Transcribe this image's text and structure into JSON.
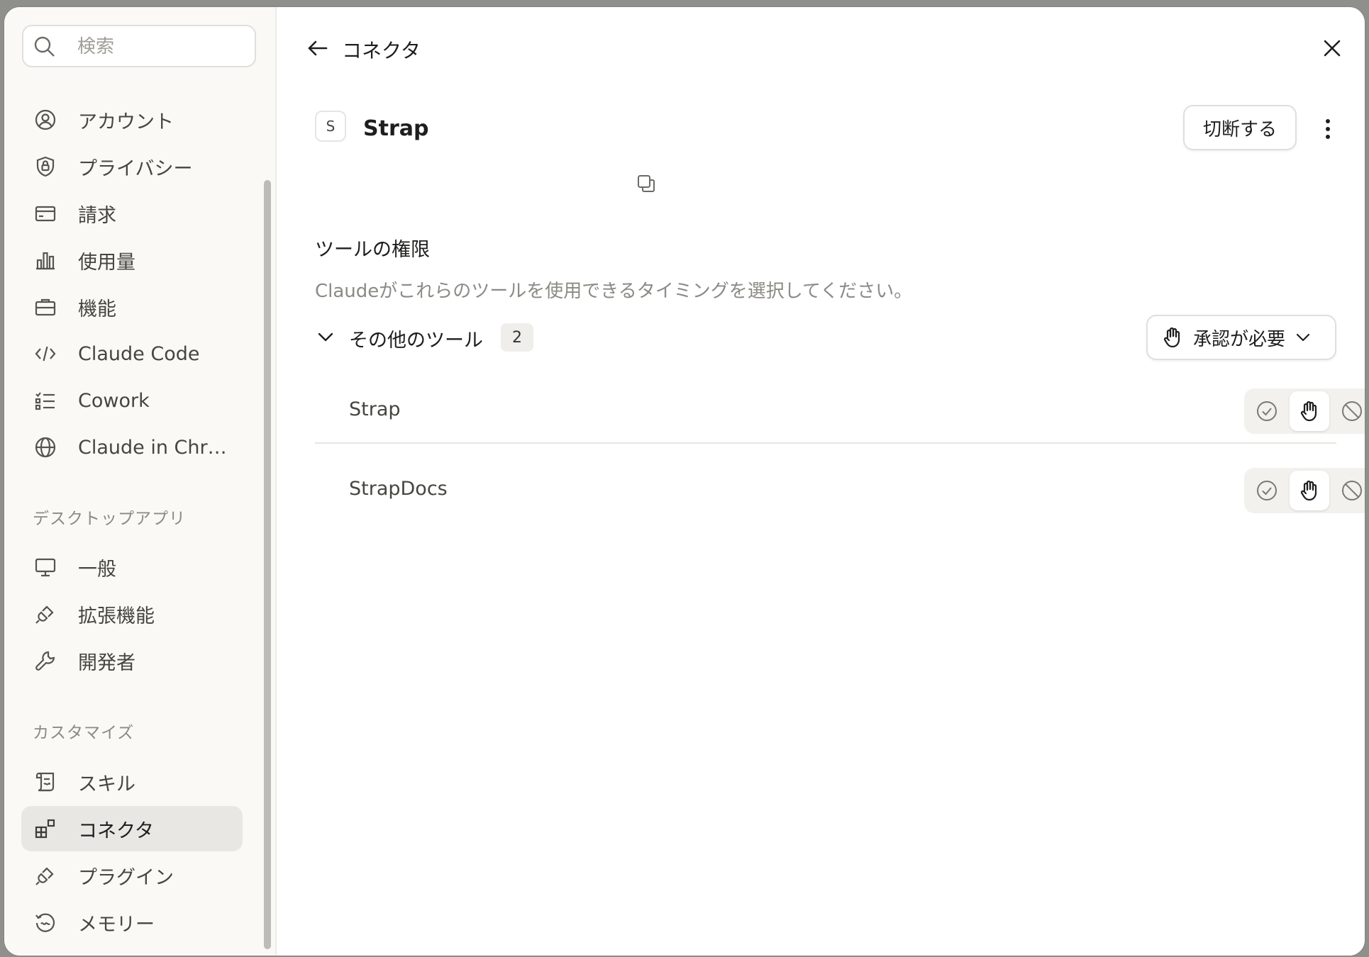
{
  "search": {
    "placeholder": "検索"
  },
  "sidebar": {
    "items": [
      {
        "label": "アカウント",
        "icon": "account-icon"
      },
      {
        "label": "プライバシー",
        "icon": "shield-lock-icon"
      },
      {
        "label": "請求",
        "icon": "credit-card-icon"
      },
      {
        "label": "使用量",
        "icon": "bar-chart-icon"
      },
      {
        "label": "機能",
        "icon": "briefcase-icon"
      },
      {
        "label": "Claude Code",
        "icon": "code-icon"
      },
      {
        "label": "Cowork",
        "icon": "checklist-icon"
      },
      {
        "label": "Claude in Chr…",
        "icon": "globe-icon"
      }
    ],
    "desktop_section_label": "デスクトップアプリ",
    "desktop_items": [
      {
        "label": "一般",
        "icon": "monitor-icon"
      },
      {
        "label": "拡張機能",
        "icon": "plug-icon"
      },
      {
        "label": "開発者",
        "icon": "wrench-icon"
      }
    ],
    "customize_section_label": "カスタマイズ",
    "customize_items": [
      {
        "label": "スキル",
        "icon": "scroll-icon"
      },
      {
        "label": "コネクタ",
        "icon": "connector-icon",
        "active": true
      },
      {
        "label": "プラグイン",
        "icon": "plug-icon"
      },
      {
        "label": "メモリー",
        "icon": "memory-icon"
      }
    ]
  },
  "header": {
    "title": "コネクタ"
  },
  "connector": {
    "badge": "S",
    "name": "Strap",
    "disconnect_label": "切断する"
  },
  "permissions": {
    "title": "ツールの権限",
    "description": "Claudeがこれらのツールを使用できるタイミングを選択してください。",
    "group_label": "その他のツール",
    "group_count": "2",
    "approval_label": "承認が必要",
    "tools": [
      {
        "name": "Strap",
        "mode": "needs-approval"
      },
      {
        "name": "StrapDocs",
        "mode": "needs-approval"
      }
    ]
  }
}
